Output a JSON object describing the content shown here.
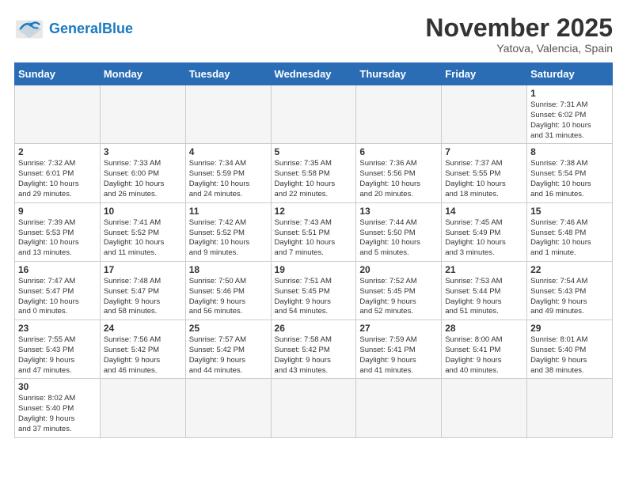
{
  "header": {
    "logo_general": "General",
    "logo_blue": "Blue",
    "month_title": "November 2025",
    "location": "Yatova, Valencia, Spain"
  },
  "weekdays": [
    "Sunday",
    "Monday",
    "Tuesday",
    "Wednesday",
    "Thursday",
    "Friday",
    "Saturday"
  ],
  "weeks": [
    [
      {
        "day": "",
        "info": ""
      },
      {
        "day": "",
        "info": ""
      },
      {
        "day": "",
        "info": ""
      },
      {
        "day": "",
        "info": ""
      },
      {
        "day": "",
        "info": ""
      },
      {
        "day": "",
        "info": ""
      },
      {
        "day": "1",
        "info": "Sunrise: 7:31 AM\nSunset: 6:02 PM\nDaylight: 10 hours\nand 31 minutes."
      }
    ],
    [
      {
        "day": "2",
        "info": "Sunrise: 7:32 AM\nSunset: 6:01 PM\nDaylight: 10 hours\nand 29 minutes."
      },
      {
        "day": "3",
        "info": "Sunrise: 7:33 AM\nSunset: 6:00 PM\nDaylight: 10 hours\nand 26 minutes."
      },
      {
        "day": "4",
        "info": "Sunrise: 7:34 AM\nSunset: 5:59 PM\nDaylight: 10 hours\nand 24 minutes."
      },
      {
        "day": "5",
        "info": "Sunrise: 7:35 AM\nSunset: 5:58 PM\nDaylight: 10 hours\nand 22 minutes."
      },
      {
        "day": "6",
        "info": "Sunrise: 7:36 AM\nSunset: 5:56 PM\nDaylight: 10 hours\nand 20 minutes."
      },
      {
        "day": "7",
        "info": "Sunrise: 7:37 AM\nSunset: 5:55 PM\nDaylight: 10 hours\nand 18 minutes."
      },
      {
        "day": "8",
        "info": "Sunrise: 7:38 AM\nSunset: 5:54 PM\nDaylight: 10 hours\nand 16 minutes."
      }
    ],
    [
      {
        "day": "9",
        "info": "Sunrise: 7:39 AM\nSunset: 5:53 PM\nDaylight: 10 hours\nand 13 minutes."
      },
      {
        "day": "10",
        "info": "Sunrise: 7:41 AM\nSunset: 5:52 PM\nDaylight: 10 hours\nand 11 minutes."
      },
      {
        "day": "11",
        "info": "Sunrise: 7:42 AM\nSunset: 5:52 PM\nDaylight: 10 hours\nand 9 minutes."
      },
      {
        "day": "12",
        "info": "Sunrise: 7:43 AM\nSunset: 5:51 PM\nDaylight: 10 hours\nand 7 minutes."
      },
      {
        "day": "13",
        "info": "Sunrise: 7:44 AM\nSunset: 5:50 PM\nDaylight: 10 hours\nand 5 minutes."
      },
      {
        "day": "14",
        "info": "Sunrise: 7:45 AM\nSunset: 5:49 PM\nDaylight: 10 hours\nand 3 minutes."
      },
      {
        "day": "15",
        "info": "Sunrise: 7:46 AM\nSunset: 5:48 PM\nDaylight: 10 hours\nand 1 minute."
      }
    ],
    [
      {
        "day": "16",
        "info": "Sunrise: 7:47 AM\nSunset: 5:47 PM\nDaylight: 10 hours\nand 0 minutes."
      },
      {
        "day": "17",
        "info": "Sunrise: 7:48 AM\nSunset: 5:47 PM\nDaylight: 9 hours\nand 58 minutes."
      },
      {
        "day": "18",
        "info": "Sunrise: 7:50 AM\nSunset: 5:46 PM\nDaylight: 9 hours\nand 56 minutes."
      },
      {
        "day": "19",
        "info": "Sunrise: 7:51 AM\nSunset: 5:45 PM\nDaylight: 9 hours\nand 54 minutes."
      },
      {
        "day": "20",
        "info": "Sunrise: 7:52 AM\nSunset: 5:45 PM\nDaylight: 9 hours\nand 52 minutes."
      },
      {
        "day": "21",
        "info": "Sunrise: 7:53 AM\nSunset: 5:44 PM\nDaylight: 9 hours\nand 51 minutes."
      },
      {
        "day": "22",
        "info": "Sunrise: 7:54 AM\nSunset: 5:43 PM\nDaylight: 9 hours\nand 49 minutes."
      }
    ],
    [
      {
        "day": "23",
        "info": "Sunrise: 7:55 AM\nSunset: 5:43 PM\nDaylight: 9 hours\nand 47 minutes."
      },
      {
        "day": "24",
        "info": "Sunrise: 7:56 AM\nSunset: 5:42 PM\nDaylight: 9 hours\nand 46 minutes."
      },
      {
        "day": "25",
        "info": "Sunrise: 7:57 AM\nSunset: 5:42 PM\nDaylight: 9 hours\nand 44 minutes."
      },
      {
        "day": "26",
        "info": "Sunrise: 7:58 AM\nSunset: 5:42 PM\nDaylight: 9 hours\nand 43 minutes."
      },
      {
        "day": "27",
        "info": "Sunrise: 7:59 AM\nSunset: 5:41 PM\nDaylight: 9 hours\nand 41 minutes."
      },
      {
        "day": "28",
        "info": "Sunrise: 8:00 AM\nSunset: 5:41 PM\nDaylight: 9 hours\nand 40 minutes."
      },
      {
        "day": "29",
        "info": "Sunrise: 8:01 AM\nSunset: 5:40 PM\nDaylight: 9 hours\nand 38 minutes."
      }
    ],
    [
      {
        "day": "30",
        "info": "Sunrise: 8:02 AM\nSunset: 5:40 PM\nDaylight: 9 hours\nand 37 minutes."
      },
      {
        "day": "",
        "info": ""
      },
      {
        "day": "",
        "info": ""
      },
      {
        "day": "",
        "info": ""
      },
      {
        "day": "",
        "info": ""
      },
      {
        "day": "",
        "info": ""
      },
      {
        "day": "",
        "info": ""
      }
    ]
  ]
}
